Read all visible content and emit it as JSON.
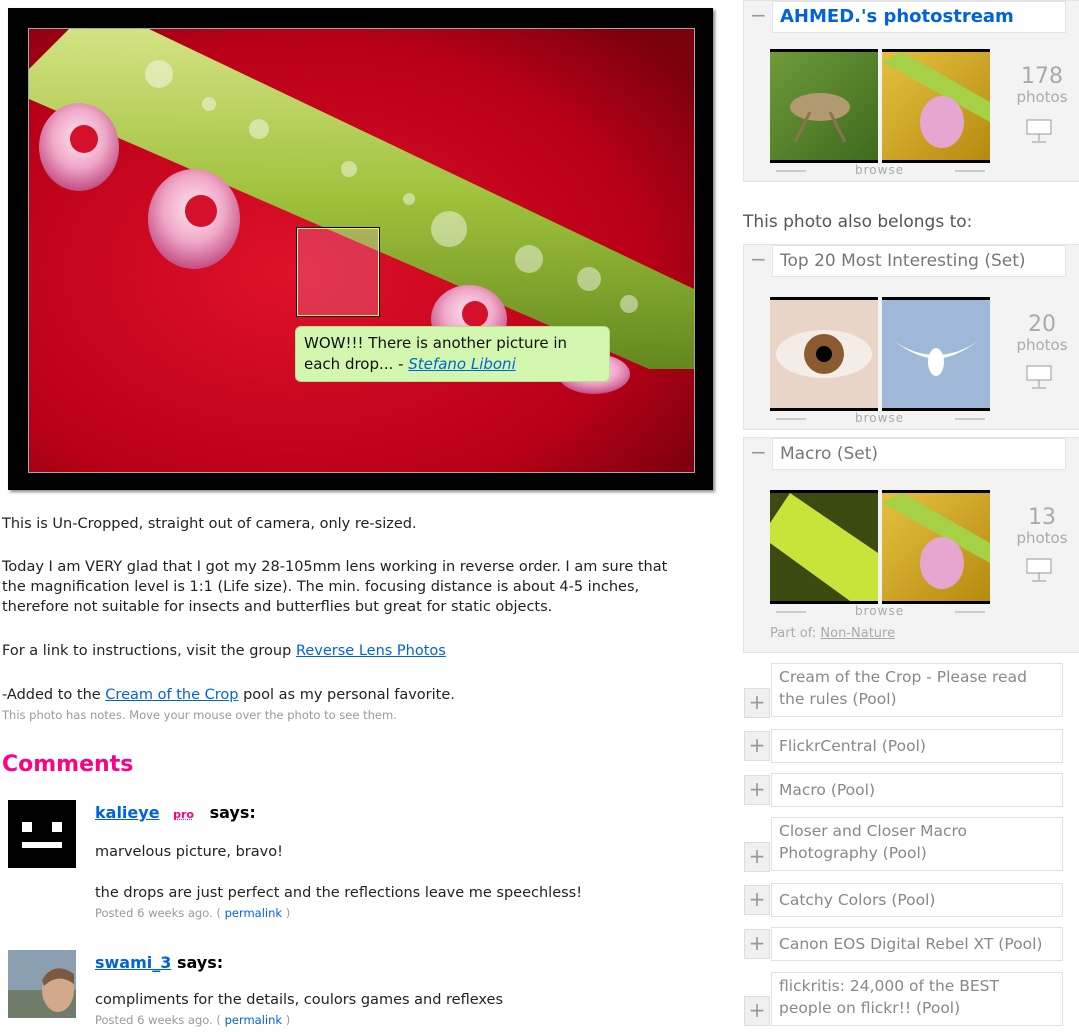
{
  "photo": {
    "note_text": "WOW!!! There is another picture in each drop... -",
    "note_author": "Stefano Liboni"
  },
  "description": {
    "line1": "This is Un-Cropped, straight out of camera, only re-sized.",
    "para2": "Today I am VERY glad that I got my 28-105mm lens working in reverse order. I am sure that the magnification level is 1:1 (Life size). The min. focusing distance is about 4-5 inches, therefore not suitable for insects and butterflies but great for static objects.",
    "para3_prefix": "For a link to instructions, visit the group",
    "para3_link": "Reverse Lens Photos",
    "para4_prefix": "-Added to the",
    "para4_link": "Cream of the Crop",
    "para4_suffix": "pool as my personal favorite.",
    "notes_hint": "This photo has notes. Move your mouse over the photo to see them."
  },
  "comments": {
    "title": "Comments",
    "items": [
      {
        "user": "kalieye",
        "pro": "pro",
        "says": "says:",
        "text1": "marvelous picture, bravo!",
        "text2": "the drops are just perfect and the reflections leave me speechless!",
        "posted": "Posted 6 weeks ago. (",
        "permalink": "permalink",
        "close": ")"
      },
      {
        "user": "swami_3",
        "says": "says:",
        "text1": "compliments for the details, coulors games and reflexes",
        "posted": "Posted 6 weeks ago. (",
        "permalink": "permalink",
        "close": ")"
      }
    ]
  },
  "sidebar": {
    "photostream": {
      "title": "AHMED.'s photostream",
      "count": "178",
      "unit": "photos",
      "browse": "browse"
    },
    "belongs_label": "This photo also belongs to:",
    "sets": [
      {
        "title": "Top 20 Most Interesting (Set)",
        "count": "20",
        "unit": "photos",
        "browse": "browse"
      },
      {
        "title": "Macro (Set)",
        "count": "13",
        "unit": "photos",
        "browse": "browse",
        "part_of_label": "Part of:",
        "part_of_link": "Non-Nature"
      }
    ],
    "pools": [
      "Cream of the Crop - Please read the rules (Pool)",
      "FlickrCentral (Pool)",
      "Macro (Pool)",
      "Closer and Closer Macro Photography (Pool)",
      "Catchy Colors (Pool)",
      "Canon EOS Digital Rebel XT (Pool)",
      "flickritis: 24,000 of the BEST people on flickr!! (Pool)"
    ],
    "minus_symbol": "−",
    "plus_symbol": "+"
  },
  "colors": {
    "accent_pink": "#ff0084",
    "link_blue": "#0063dc",
    "note_green": "#d4f7b0"
  }
}
